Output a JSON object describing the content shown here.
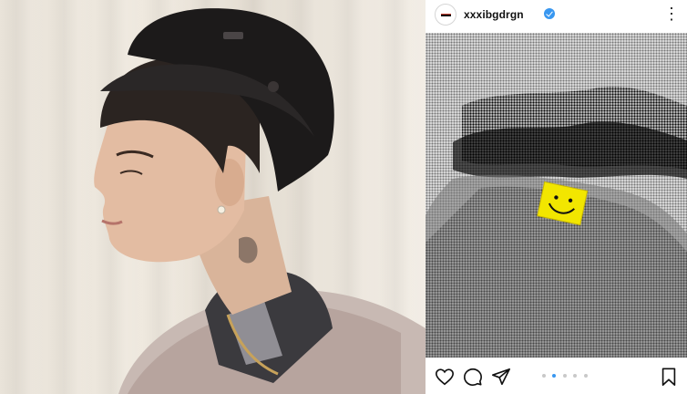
{
  "post": {
    "username": "xxxibgdrgn",
    "verified": true,
    "carousel": {
      "total": 5,
      "active": 2
    }
  },
  "icons": {
    "more": "more-options-icon",
    "like": "heart-icon",
    "comment": "comment-icon",
    "share": "send-icon",
    "save": "bookmark-icon"
  },
  "colors": {
    "verified_badge": "#3897f0",
    "smiley_sticker": "#f2e600",
    "background": "#ffffff"
  }
}
